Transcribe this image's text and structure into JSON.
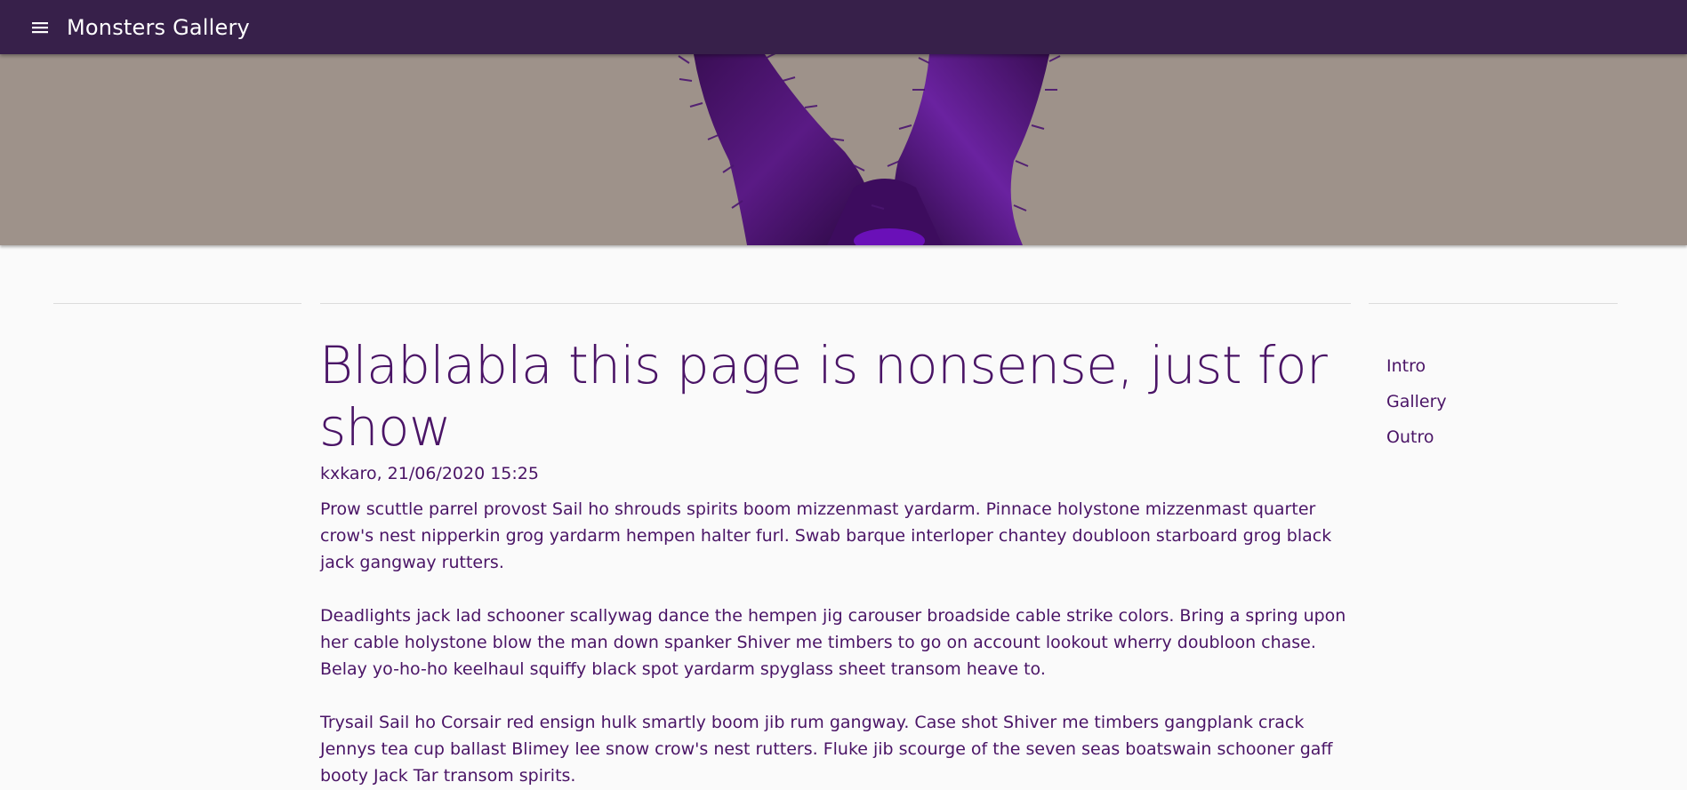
{
  "appbar": {
    "title": "Monsters Gallery",
    "menu_icon": "menu-icon",
    "background_color": "#37204a"
  },
  "hero": {
    "background_color": "#9e928a",
    "image_subject": "purple-furry-monster"
  },
  "article": {
    "title": "Blablabla this page is nonsense, just for show",
    "byline": "kxkaro, 21/06/2020 15:25",
    "paragraphs": [
      "Prow scuttle parrel provost Sail ho shrouds spirits boom mizzenmast yardarm. Pinnace holystone mizzenmast quarter crow's nest nipperkin grog yardarm hempen halter furl. Swab barque interloper chantey doubloon starboard grog black jack gangway rutters.",
      "Deadlights jack lad schooner scallywag dance the hempen jig carouser broadside cable strike colors. Bring a spring upon her cable holystone blow the man down spanker Shiver me timbers to go on account lookout wherry doubloon chase. Belay yo-ho-ho keelhaul squiffy black spot yardarm spyglass sheet transom heave to.",
      "Trysail Sail ho Corsair red ensign hulk smartly boom jib rum gangway. Case shot Shiver me timbers gangplank crack Jennys tea cup ballast Blimey lee snow crow's nest rutters. Fluke jib scourge of the seven seas boatswain schooner gaff booty Jack Tar transom spirits."
    ],
    "text_color": "#4a1466"
  },
  "toc": {
    "items": [
      "Intro",
      "Gallery",
      "Outro"
    ]
  }
}
